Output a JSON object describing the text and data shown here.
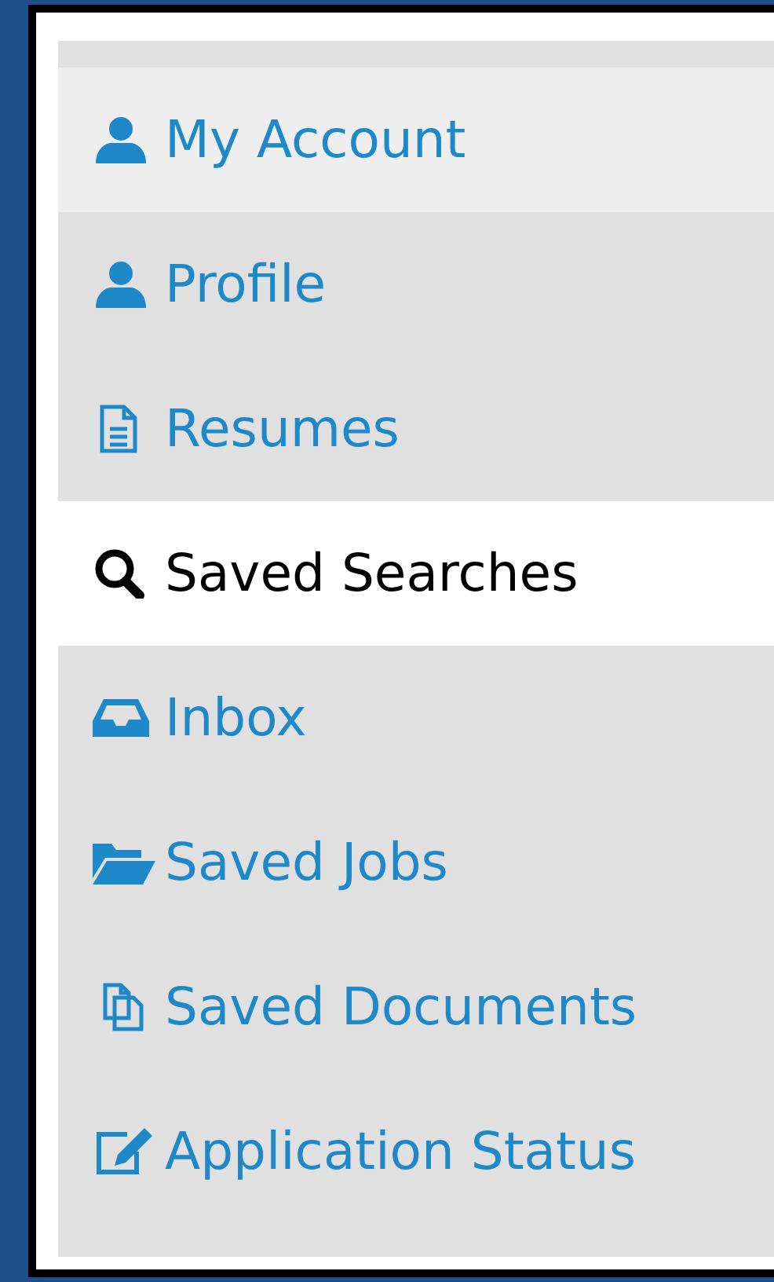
{
  "menu": {
    "items": [
      {
        "label": "My Account",
        "kind": "header",
        "selected": false
      },
      {
        "label": "Profile",
        "kind": "link",
        "selected": false
      },
      {
        "label": "Resumes",
        "kind": "link",
        "selected": false
      },
      {
        "label": "Saved Searches",
        "kind": "link",
        "selected": true
      },
      {
        "label": "Inbox",
        "kind": "link",
        "selected": false
      },
      {
        "label": "Saved Jobs",
        "kind": "link",
        "selected": false
      },
      {
        "label": "Saved Documents",
        "kind": "link",
        "selected": false
      },
      {
        "label": "Application Status",
        "kind": "link",
        "selected": false
      }
    ]
  }
}
